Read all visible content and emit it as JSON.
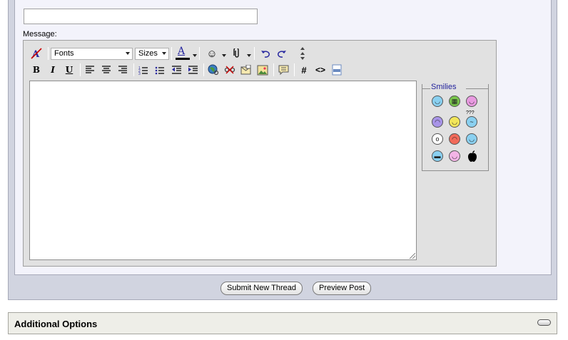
{
  "form": {
    "subject_value": "",
    "message_label": "Message:"
  },
  "toolbar": {
    "row1": {
      "remove_format_icon": "remove-format-icon",
      "font_select": "Fonts",
      "size_select": "Sizes",
      "text_color_glyph": "A",
      "text_color_bar": "#000000",
      "smilies_icon": "smiley-icon",
      "attach_icon": "paperclip-icon",
      "undo_icon": "undo-icon",
      "redo_icon": "redo-icon",
      "resize_icon": "resize-icon"
    },
    "row2": {
      "bold": "B",
      "italic": "I",
      "underline": "U",
      "align_left_icon": "align-left-icon",
      "align_center_icon": "align-center-icon",
      "align_right_icon": "align-right-icon",
      "ordered_list_icon": "ordered-list-icon",
      "unordered_list_icon": "unordered-list-icon",
      "outdent_icon": "outdent-icon",
      "indent_icon": "indent-icon",
      "link_icon": "link-icon",
      "unlink_icon": "unlink-icon",
      "email_icon": "email-icon",
      "image_icon": "image-icon",
      "quote_icon": "quote-icon",
      "code_glyph": "#",
      "html_glyph": "<>",
      "php_icon": "php-icon"
    }
  },
  "editor": {
    "text": ""
  },
  "smilies": {
    "title": "Smilies",
    "items": [
      {
        "icon": "smile-icon",
        "color": "#8ad0f0",
        "glyph": "◡"
      },
      {
        "icon": "grin-icon",
        "color": "#79c64b",
        "glyph": "▦"
      },
      {
        "icon": "tongue-icon",
        "color": "#e89ae0",
        "glyph": "◡"
      },
      {
        "icon": "frown-icon",
        "color": "#a894e8",
        "glyph": "◠"
      },
      {
        "icon": "happy-icon",
        "color": "#f2e65a",
        "glyph": "◡"
      },
      {
        "icon": "confused-icon",
        "color": "#8ad0f0",
        "glyph": "~"
      },
      {
        "icon": "eek-icon",
        "color": "#ffffff",
        "glyph": "o"
      },
      {
        "icon": "mad-icon",
        "color": "#f26a5a",
        "glyph": "◠"
      },
      {
        "icon": "rolleyes-icon",
        "color": "#8ad0f0",
        "glyph": "◡"
      },
      {
        "icon": "cool-icon",
        "color": "#8ad0f0",
        "glyph": "▬"
      },
      {
        "icon": "wink-icon",
        "color": "#f4b4e6",
        "glyph": "◡"
      },
      {
        "icon": "apple-icon",
        "color": "#000000",
        "glyph": "●"
      }
    ],
    "confused_label": "???"
  },
  "actions": {
    "submit_label": "Submit New Thread",
    "preview_label": "Preview Post"
  },
  "additional_options": {
    "title": "Additional Options"
  }
}
